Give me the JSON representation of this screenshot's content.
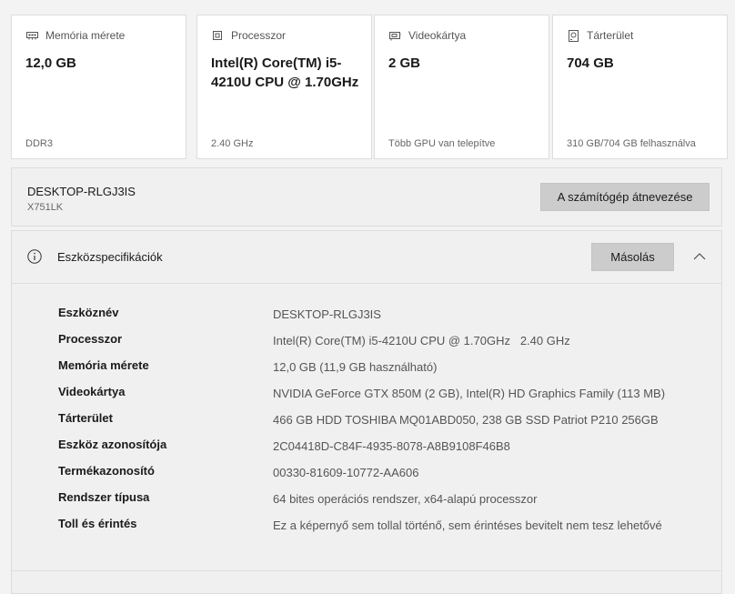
{
  "cards": [
    {
      "header": "Memória mérete",
      "icon": "ram-icon",
      "value": "12,0 GB",
      "footer": "DDR3"
    },
    {
      "header": "Processzor",
      "icon": "cpu-icon",
      "value": "Intel(R) Core(TM) i5-4210U CPU @ 1.70GHz",
      "footer": "2.40 GHz"
    },
    {
      "header": "Videokártya",
      "icon": "gpu-icon",
      "value": "2 GB",
      "footer": "Több GPU van telepítve"
    },
    {
      "header": "Tárterület",
      "icon": "storage-icon",
      "value": "704 GB",
      "footer": "310 GB/704 GB felhasználva"
    }
  ],
  "device": {
    "name": "DESKTOP-RLGJ3IS",
    "model": "X751LK",
    "rename_button": "A számítógép átnevezése"
  },
  "specs": {
    "title": "Eszközspecifikációk",
    "copy_button": "Másolás",
    "rows": [
      {
        "label": "Eszköznév",
        "value": "DESKTOP-RLGJ3IS"
      },
      {
        "label": "Processzor",
        "value": "Intel(R) Core(TM) i5-4210U CPU @ 1.70GHz   2.40 GHz"
      },
      {
        "label": "Memória mérete",
        "value": "12,0 GB (11,9 GB használható)"
      },
      {
        "label": "Videokártya",
        "value": "NVIDIA GeForce GTX 850M (2 GB), Intel(R) HD Graphics Family (113 MB)"
      },
      {
        "label": "Tárterület",
        "value": "466 GB HDD TOSHIBA MQ01ABD050, 238 GB SSD Patriot P210 256GB"
      },
      {
        "label": "Eszköz azonosítója",
        "value": "2C04418D-C84F-4935-8078-A8B9108F46B8"
      },
      {
        "label": "Termékazonosító",
        "value": "00330-81609-10772-AA606"
      },
      {
        "label": "Rendszer típusa",
        "value": "64 bites operációs rendszer, x64-alapú processzor"
      },
      {
        "label": "Toll és érintés",
        "value": "Ez a képernyő sem tollal történő, sem érintéses bevitelt nem tesz lehetővé"
      }
    ]
  }
}
